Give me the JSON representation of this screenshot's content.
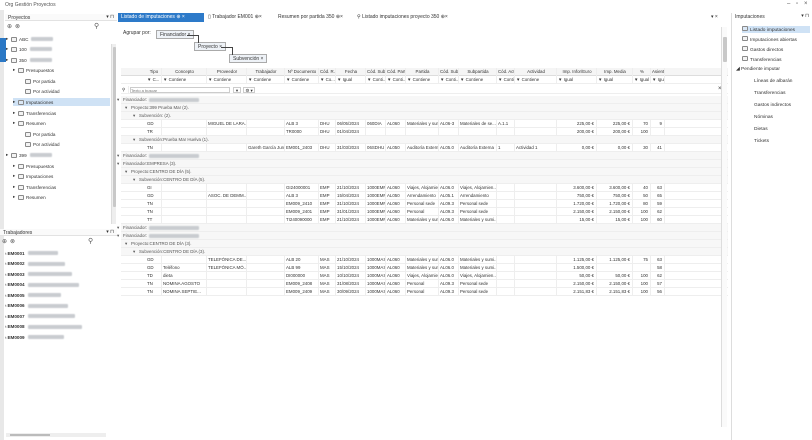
{
  "app": {
    "title": "Org Gestión Proyectos"
  },
  "left_top": {
    "header": "Proyectos",
    "tree": [
      {
        "label": "ABC",
        "blur": true,
        "indent": 0
      },
      {
        "label": "100",
        "blur": true,
        "indent": 0
      },
      {
        "label": "350",
        "blur": true,
        "indent": 0
      },
      {
        "label": "Presupuestos",
        "indent": 1
      },
      {
        "label": "Por partida",
        "indent": 2
      },
      {
        "label": "Por actividad",
        "indent": 2
      },
      {
        "label": "Imputaciones",
        "indent": 1,
        "selected": true
      },
      {
        "label": "Transferencias",
        "indent": 1
      },
      {
        "label": "Resumen",
        "indent": 1
      },
      {
        "label": "Por partida",
        "indent": 2
      },
      {
        "label": "Por actividad",
        "indent": 2
      },
      {
        "label": "399",
        "blur": true,
        "indent": 0
      },
      {
        "label": "Presupuestos",
        "indent": 1
      },
      {
        "label": "Imputaciones",
        "indent": 1
      },
      {
        "label": "Transferencias",
        "indent": 1
      },
      {
        "label": "Resumen",
        "indent": 1
      }
    ]
  },
  "left_bottom": {
    "header": "Trabajadores",
    "items": [
      "EM0001",
      "EM0002",
      "EM0003",
      "EM0004",
      "EM0005",
      "EM0006",
      "EM0007",
      "EM0008",
      "EM0009"
    ]
  },
  "tabs": [
    {
      "label": "Listado de imputaciones",
      "active": true
    },
    {
      "label": "Trabajador EM001"
    },
    {
      "label": "Resumen por partida 350"
    },
    {
      "label": "Listado imputaciones proyecto 350"
    }
  ],
  "grouping": {
    "label": "Agrupar por:",
    "chips": [
      "Financiador",
      "Proyecto",
      "Subvención"
    ]
  },
  "columns": [
    "Tipo",
    "Concepto",
    "Proveedor",
    "Trabajador",
    "Nº Documento",
    "Cód. R...",
    "Fecha",
    "Cód. Subv.",
    "Cód. Part...",
    "Partida",
    "Cód. Sub...",
    "Subpartida",
    "Cód. Acti...",
    "Actividad",
    "Imp. Infor/Euro",
    "Imp. Media",
    "%",
    "Asiento"
  ],
  "filters": [
    "C...",
    "Contiene",
    "Contiene",
    "Contiene",
    "Contiene",
    "Co...",
    "Igual",
    "Conti...",
    "Conti...",
    "Contiene",
    "Conti...",
    "Contiene",
    "Conti...",
    "Contiene",
    "Igual",
    "Igual",
    "Igual",
    "Igual"
  ],
  "search": {
    "placeholder": "Texto a buscar"
  },
  "groups": {
    "g1": "Financiador:",
    "g1p": "Proyecto:399 Prueba Mar (2).",
    "g1s1": "Subvención: (2).",
    "g1s2": "Subvención:Prueba Mar Huelva (1).",
    "g2": "Financiador:",
    "g3": "Financiador:EMPRESA (3).",
    "g3p": "Proyecto:CENTRO DE DÍA (5).",
    "g3s": "Subvención:CENTRO DE DÍA (5).",
    "g4": "Financiador:",
    "g5": "Financiador:",
    "g5p": "Proyecto:CENTRO DE DÍA (3).",
    "g5s": "Subvención:CENTRO DE DÍA (3)."
  },
  "rows_a": [
    [
      "GD",
      "",
      "MIGUEL DE LARA...",
      "",
      "ALB 3",
      "DHU",
      "06/05/2024",
      "060DIA",
      "AL060",
      "Materiales y sumi...",
      "AL06-3",
      "Materiales de se...",
      "A.1.1",
      "",
      "225,00 €",
      "225,00 €",
      "70",
      "9"
    ],
    [
      "TR",
      "",
      "",
      "",
      "TR0000",
      "DHU",
      "01/04/2024",
      "",
      "",
      "",
      "",
      "",
      "",
      "",
      "200,00 €",
      "200,00 €",
      "100",
      ""
    ]
  ],
  "rows_b": [
    [
      "TN",
      "",
      "",
      "Gareth García Junio",
      "EM001_2403",
      "DHU",
      "31/03/2024",
      "06SDHU",
      "AL050",
      "Auditoría Externa",
      "AL05.0",
      "Auditoría Externa",
      "1",
      "Actividad 1",
      "0,00 €",
      "0,00 €",
      "30",
      "41"
    ]
  ],
  "rows_c": [
    [
      "GI",
      "",
      "",
      "",
      "GI24000001",
      "EMP",
      "21/10/2024",
      "1000EMP",
      "AL060",
      "Viajes, Alojamien...",
      "AL06.0",
      "Viajes, Alojamien...",
      "",
      "",
      "3.600,00 €",
      "3.600,00 €",
      "40",
      "63"
    ],
    [
      "GD",
      "",
      "ASOC. DE DEMM...",
      "",
      "ALB 3",
      "EMP",
      "15/04/2024",
      "1000EMP",
      "AL050",
      "Arrendamiento",
      "AL05.1",
      "Arrendamiento",
      "",
      "",
      "750,00 €",
      "750,00 €",
      "50",
      "65"
    ],
    [
      "TN",
      "",
      "",
      "",
      "EM009_2410",
      "EMP",
      "31/10/2024",
      "1000EMP",
      "AL060",
      "Personal sede",
      "AL09.3",
      "Personal sede",
      "",
      "",
      "1.720,00 €",
      "1.720,00 €",
      "80",
      "59"
    ],
    [
      "TN",
      "",
      "",
      "",
      "EM009_2401",
      "EMP",
      "31/01/2024",
      "1000EMP",
      "AL060",
      "Personal",
      "AL09.3",
      "Personal sede",
      "",
      "",
      "2.150,00 €",
      "2.150,00 €",
      "100",
      "62"
    ],
    [
      "TT",
      "",
      "",
      "",
      "TI240090000",
      "EMP",
      "21/10/2024",
      "1000EMP",
      "AL060",
      "Materiales y sumi...",
      "AL06.0",
      "Materiales y sumi...",
      "",
      "",
      "15,00 €",
      "15,00 €",
      "100",
      "60"
    ]
  ],
  "rows_d": [
    [
      "GD",
      "",
      "TELEFÓNICA DE...",
      "",
      "ALB 20",
      "MAS",
      "21/10/2024",
      "1000MAS",
      "AL060",
      "Materiales y sumi...",
      "AL06.0",
      "Materiales y sumi...",
      "",
      "",
      "1.125,00 €",
      "1.125,00 €",
      "75",
      "63"
    ],
    [
      "GD",
      "Teléfono",
      "TELEFÓNICA MÓ...",
      "",
      "ALB 99",
      "MAS",
      "15/10/2024",
      "1000MAS",
      "AL060",
      "Materiales y sumi...",
      "AL06.0",
      "Materiales y sumi...",
      "",
      "",
      "1.500,00 €",
      "",
      "",
      "58"
    ],
    [
      "TD",
      "dieta",
      "",
      "",
      "DI000000",
      "MAS",
      "10/10/2024",
      "1000MAS",
      "AL060",
      "Viajes, Alojamien...",
      "AL06.0",
      "Viajes, Alojamien...",
      "",
      "",
      "50,00 €",
      "50,00 €",
      "100",
      "62"
    ],
    [
      "TN",
      "NOMINA AGOSTO",
      "",
      "",
      "EM009_2408",
      "MAS",
      "31/08/2024",
      "1000MAS",
      "AL060",
      "Personal",
      "AL09.3",
      "Personal sede",
      "",
      "",
      "2.150,00 €",
      "2.150,00 €",
      "100",
      "57"
    ],
    [
      "TN",
      "NOMINA SEPTIE...",
      "",
      "",
      "EM009_2409",
      "MAS",
      "30/09/2024",
      "1000MAS",
      "AL060",
      "Personal",
      "AL09.3",
      "Personal sede",
      "",
      "",
      "2.151,83 €",
      "2.151,83 €",
      "100",
      "56"
    ]
  ],
  "right": {
    "header": "Imputaciones",
    "items": [
      {
        "label": "Listado imputaciones",
        "selected": true
      },
      {
        "label": "Imputaciones abiertas"
      },
      {
        "label": "Gastos directos"
      },
      {
        "label": "Transferencias"
      }
    ],
    "group": "Pendiente imputar",
    "sub": [
      "Líneas de albarán",
      "Transferencias",
      "Gastos indirectos",
      "Nóminas",
      "Dietas",
      "Tickets"
    ]
  }
}
